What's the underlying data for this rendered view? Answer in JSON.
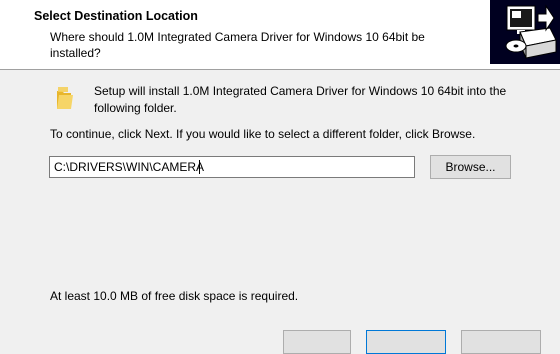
{
  "header": {
    "title": "Select Destination Location",
    "subtitle": "Where should 1.0M Integrated Camera Driver for Windows 10 64bit be installed?",
    "image_icon": "computer-install-icon"
  },
  "main": {
    "folder_icon": "folder-icon",
    "intro": "Setup will install 1.0M Integrated Camera Driver for Windows 10 64bit into the following folder.",
    "instructions": "To continue, click Next. If you would like to select a different folder, click Browse.",
    "path_value": "C:\\DRIVERS\\WIN\\CAMERA",
    "browse_label": "Browse...",
    "disk_space": "At least 10.0 MB of free disk space is required."
  },
  "colors": {
    "header_bg": "#ffffff",
    "body_bg": "#f0f0f0",
    "button_bg": "#e1e1e1",
    "focus_border": "#0078d7"
  }
}
